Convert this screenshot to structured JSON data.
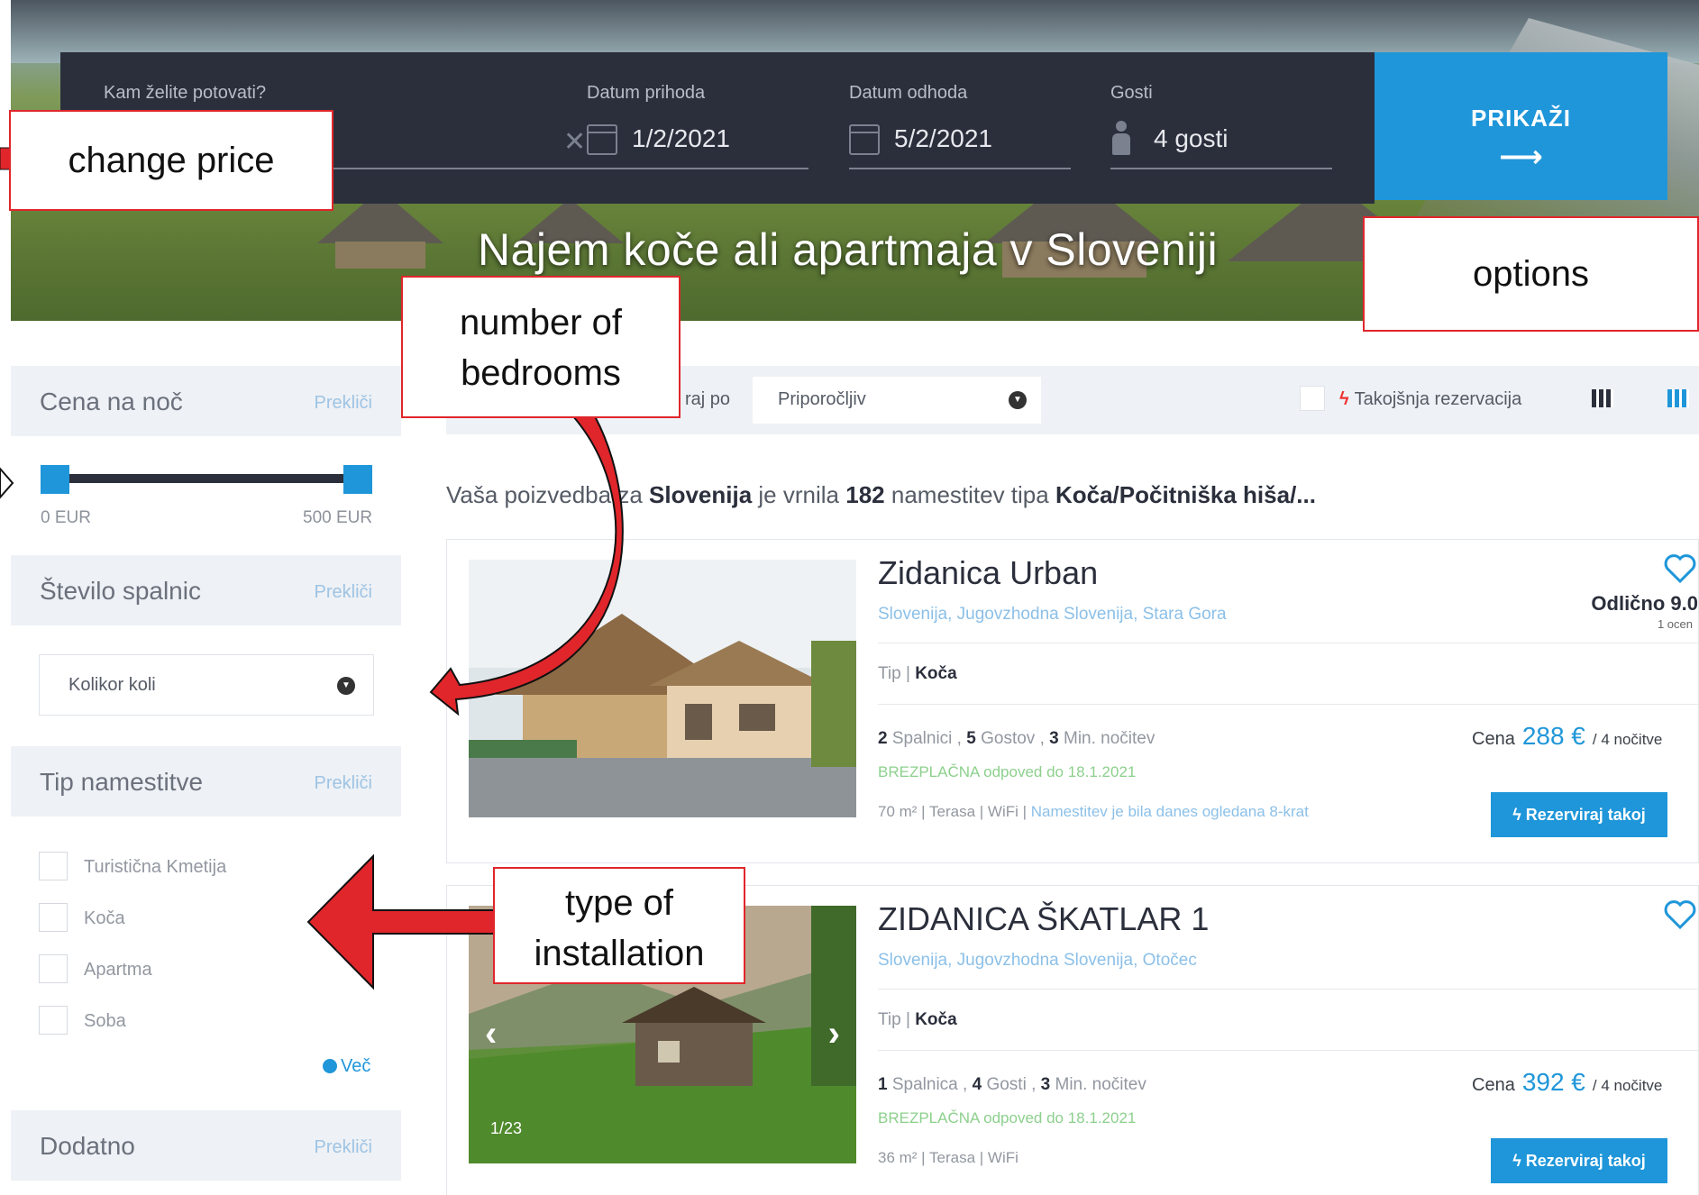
{
  "search": {
    "destination_label": "Kam želite potovati?",
    "arrival_label": "Datum prihoda",
    "arrival_value": "1/2/2021",
    "departure_label": "Datum odhoda",
    "departure_value": "5/2/2021",
    "guests_label": "Gosti",
    "guests_value": "4 gosti",
    "submit_label": "PRIKAŽI",
    "submit_arrow": "⟶"
  },
  "hero": {
    "title": "Najem koče ali apartmaja v Sloveniji"
  },
  "filters": {
    "price": {
      "heading": "Cena na noč",
      "reset": "Prekliči",
      "min": "0 EUR",
      "max": "500 EUR",
      "min_fraction": 0.0,
      "max_fraction": 1.0
    },
    "bedrooms": {
      "heading": "Število spalnic",
      "reset": "Prekliči",
      "selected": "Kolikor koli"
    },
    "type": {
      "heading": "Tip namestitve",
      "reset": "Prekliči",
      "options": [
        "Turistična Kmetija",
        "Koča",
        "Apartma",
        "Soba"
      ],
      "more": "Več"
    },
    "extra": {
      "heading": "Dodatno",
      "reset": "Prekliči"
    }
  },
  "toolbar": {
    "sort_label": "raj po",
    "sort_value": "Priporočljiv",
    "instant_label": "Takojšnja rezervacija"
  },
  "results": {
    "prefix": "Vaša poizvedba za",
    "place": "Slovenija",
    "middle": "je vrnila",
    "count": "182",
    "middle2": "namestitev tipa",
    "types": "Koča/Počitniška hiša/..."
  },
  "listings": [
    {
      "title": "Zidanica Urban",
      "location": "Slovenija, Jugovzhodna Slovenija, Stara Gora",
      "tip_label": "Tip |",
      "tip_value": "Koča",
      "bedrooms": "2",
      "bedrooms_label": "Spalnici ,",
      "guests": "5",
      "guests_label": "Gostov ,",
      "min_nights": "3",
      "min_nights_label": "Min. nočitev",
      "free_cancel": "BREZPLAČNA odpoved do 18.1.2021",
      "features": "70 m² | Terasa | WiFi |",
      "features_note": "Namestitev je bila danes ogledana 8-krat",
      "rating": "Odlično 9.0",
      "rating_count": "1 ocen",
      "price_label": "Cena",
      "price": "288 €",
      "nights": "/ 4 nočitve",
      "book_label": "Rezerviraj takoj"
    },
    {
      "title": "ZIDANICA ŠKATLAR 1",
      "location": "Slovenija, Jugovzhodna Slovenija, Otočec",
      "tip_label": "Tip |",
      "tip_value": "Koča",
      "bedrooms": "1",
      "bedrooms_label": "Spalnica ,",
      "guests": "4",
      "guests_label": "Gosti ,",
      "min_nights": "3",
      "min_nights_label": "Min. nočitev",
      "free_cancel": "BREZPLAČNA odpoved do 18.1.2021",
      "features": "36 m² | Terasa | WiFi",
      "image_counter": "1/23",
      "price_label": "Cena",
      "price": "392 €",
      "nights": "/ 4 nočitve",
      "book_label": "Rezerviraj takoj"
    }
  ],
  "annotations": {
    "change_price": "change price",
    "options": "options",
    "number_of_bedrooms": "number of bedrooms",
    "type_of_installation": "type of installation"
  },
  "colors": {
    "accent": "#1f96d9",
    "dark": "#2b2f3c",
    "annotation": "#e0262b"
  }
}
